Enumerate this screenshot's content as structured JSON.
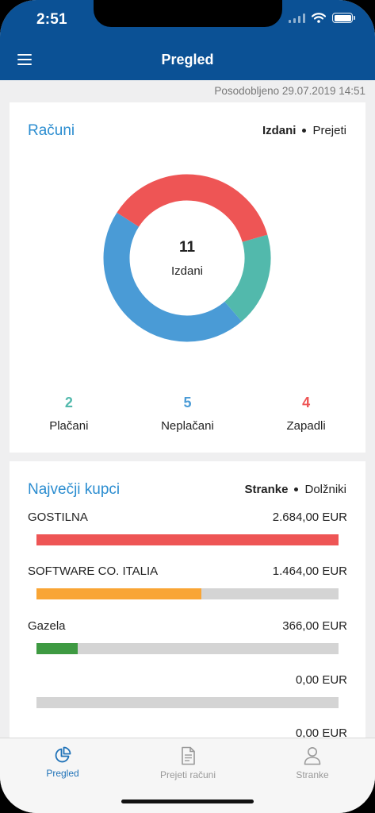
{
  "status": {
    "time": "2:51"
  },
  "header": {
    "title": "Pregled"
  },
  "updated": "Posodobljeno  29.07.2019 14:51",
  "invoices": {
    "title": "Računi",
    "toggle": {
      "active": "Izdani",
      "inactive": "Prejeti"
    },
    "donut": {
      "count": "11",
      "label": "Izdani"
    },
    "stats": [
      {
        "value": "2",
        "label": "Plačani",
        "color": "#52b9ac"
      },
      {
        "value": "5",
        "label": "Neplačani",
        "color": "#4a9bd6"
      },
      {
        "value": "4",
        "label": "Zapadli",
        "color": "#ee5555"
      }
    ],
    "segments": [
      {
        "name": "Plačani",
        "value": 2,
        "color": "#52b9ac"
      },
      {
        "name": "Neplačani",
        "value": 5,
        "color": "#4a9bd6"
      },
      {
        "name": "Zapadli",
        "value": 4,
        "color": "#ee5555"
      }
    ]
  },
  "customers": {
    "title": "Največji kupci",
    "toggle": {
      "active": "Stranke",
      "inactive": "Dolžniki"
    },
    "items": [
      {
        "name": "GOSTILNA",
        "amount": "2.684,00 EUR",
        "fraction": 1.0,
        "color": "#ee5555"
      },
      {
        "name": "SOFTWARE CO.  ITALIA",
        "amount": "1.464,00 EUR",
        "fraction": 0.546,
        "color": "#f9a535"
      },
      {
        "name": "Gazela",
        "amount": "366,00 EUR",
        "fraction": 0.136,
        "color": "#3e9a42"
      },
      {
        "name": "",
        "amount": "0,00 EUR",
        "fraction": 0,
        "color": "#d4d4d4"
      },
      {
        "name": "",
        "amount": "0,00 EUR",
        "fraction": 0,
        "color": "#d4d4d4"
      }
    ]
  },
  "tabs": [
    {
      "label": "Pregled",
      "icon": "pie-chart-icon",
      "active": true
    },
    {
      "label": "Prejeti računi",
      "icon": "document-icon",
      "active": false
    },
    {
      "label": "Stranke",
      "icon": "person-icon",
      "active": false
    }
  ],
  "colors": {
    "primary": "#0b5195",
    "accent": "#2b8dd0",
    "inactive": "#999999"
  }
}
